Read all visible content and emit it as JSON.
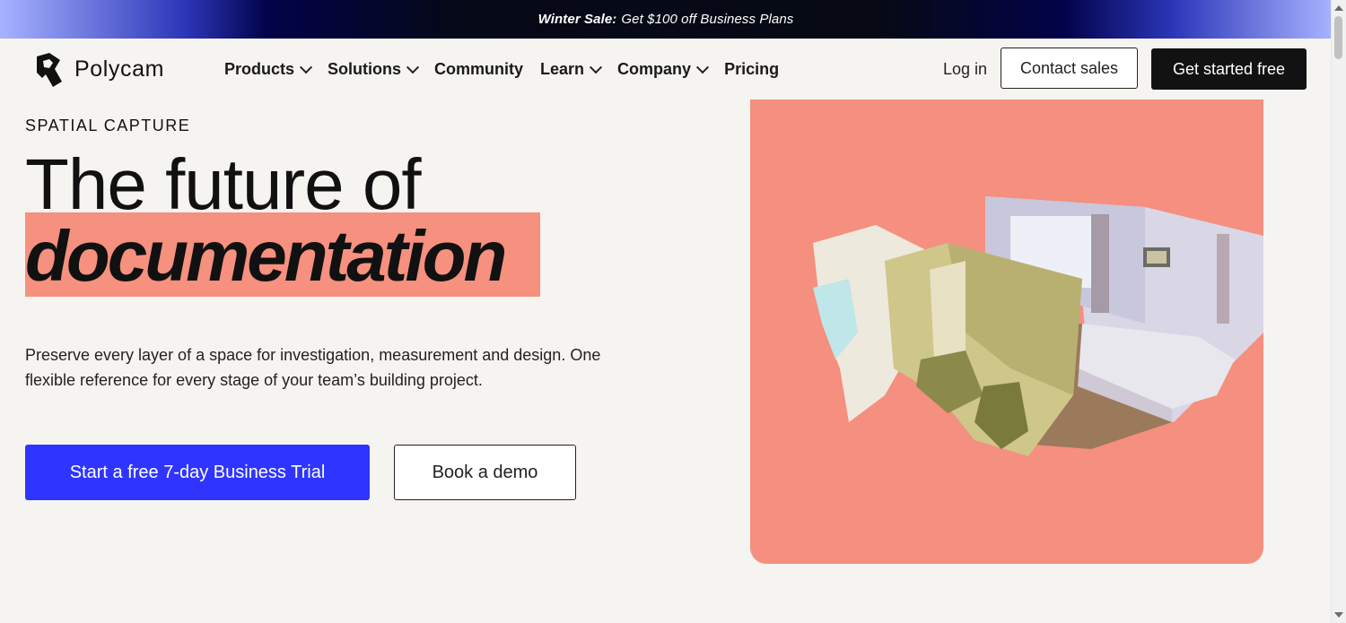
{
  "promo": {
    "bold": "Winter Sale:",
    "text": "Get $100 off Business Plans"
  },
  "nav": {
    "brand": "Polycam",
    "items": [
      {
        "label": "Products",
        "has_dropdown": true
      },
      {
        "label": "Solutions",
        "has_dropdown": true
      },
      {
        "label": "Community",
        "has_dropdown": false
      },
      {
        "label": "Learn",
        "has_dropdown": true
      },
      {
        "label": "Company",
        "has_dropdown": true
      },
      {
        "label": "Pricing",
        "has_dropdown": false
      }
    ],
    "login": "Log in",
    "contact_sales": "Contact sales",
    "get_started": "Get started free"
  },
  "hero": {
    "eyebrow": "SPATIAL CAPTURE",
    "title_line1": "The future of",
    "title_line2": "documentation",
    "description": "Preserve every layer of a space for investigation, measurement and design. One flexible reference for every stage of your team’s building project.",
    "primary_cta": "Start a free 7-day Business Trial",
    "secondary_cta": "Book a demo"
  },
  "colors": {
    "accent_blue": "#2f35ff",
    "salmon": "#f58f7f",
    "background": "#f6f4f0",
    "dark": "#121212"
  },
  "icons": [
    "polycam-logo-icon",
    "chevron-down-icon"
  ]
}
